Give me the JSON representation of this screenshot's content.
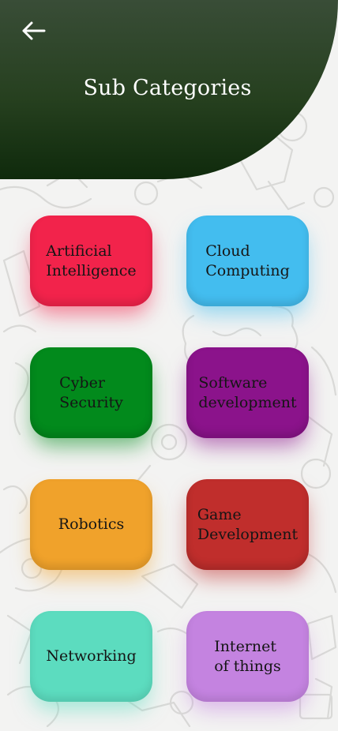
{
  "header": {
    "title": "Sub Categories",
    "back_icon": "arrow-left-icon",
    "gradient_top": "#394d37",
    "gradient_bottom": "#0f2a0c"
  },
  "categories": [
    {
      "label": "Artificial\nIntelligence",
      "color": "#f2234b"
    },
    {
      "label": "Cloud\nComputing",
      "color": "#43bdef"
    },
    {
      "label": "Cyber\nSecurity",
      "color": "#028a1c"
    },
    {
      "label": "Software\ndevelopment",
      "color": "#8b138b"
    },
    {
      "label": "Robotics",
      "color": "#f0a22b"
    },
    {
      "label": "Game\nDevelopment",
      "color": "#c02e2c"
    },
    {
      "label": "Networking",
      "color": "#5cdcbf"
    },
    {
      "label": "Internet\nof things",
      "color": "#c483e0"
    }
  ]
}
